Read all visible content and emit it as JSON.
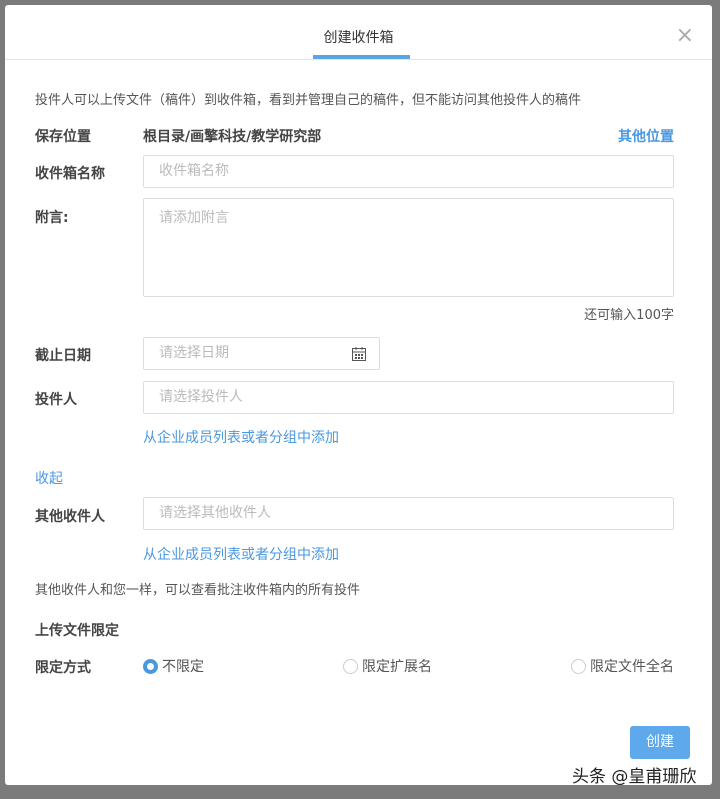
{
  "dialog": {
    "title": "创建收件箱",
    "close": "×",
    "description": "投件人可以上传文件（稿件）到收件箱，看到并管理自己的稿件，但不能访问其他投件人的稿件",
    "save_location": {
      "label": "保存位置",
      "value": "根目录/画擎科技/教学研究部",
      "link": "其他位置"
    },
    "name": {
      "label": "收件箱名称",
      "placeholder": "收件箱名称"
    },
    "note": {
      "label": "附言:",
      "placeholder": "请添加附言",
      "counter": "还可输入100字"
    },
    "deadline": {
      "label": "截止日期",
      "placeholder": "请选择日期"
    },
    "submitters": {
      "label": "投件人",
      "placeholder": "请选择投件人",
      "link": "从企业成员列表或者分组中添加"
    },
    "collapse": "收起",
    "other_recipients": {
      "label": "其他收件人",
      "placeholder": "请选择其他收件人",
      "link": "从企业成员列表或者分组中添加",
      "hint": "其他收件人和您一样，可以查看批注收件箱内的所有投件"
    },
    "upload_limit": {
      "heading": "上传文件限定",
      "label": "限定方式",
      "options": [
        "不限定",
        "限定扩展名",
        "限定文件全名"
      ],
      "selected": 0
    },
    "create_button": "创建"
  },
  "watermark": "头条 @皇甫珊欣"
}
